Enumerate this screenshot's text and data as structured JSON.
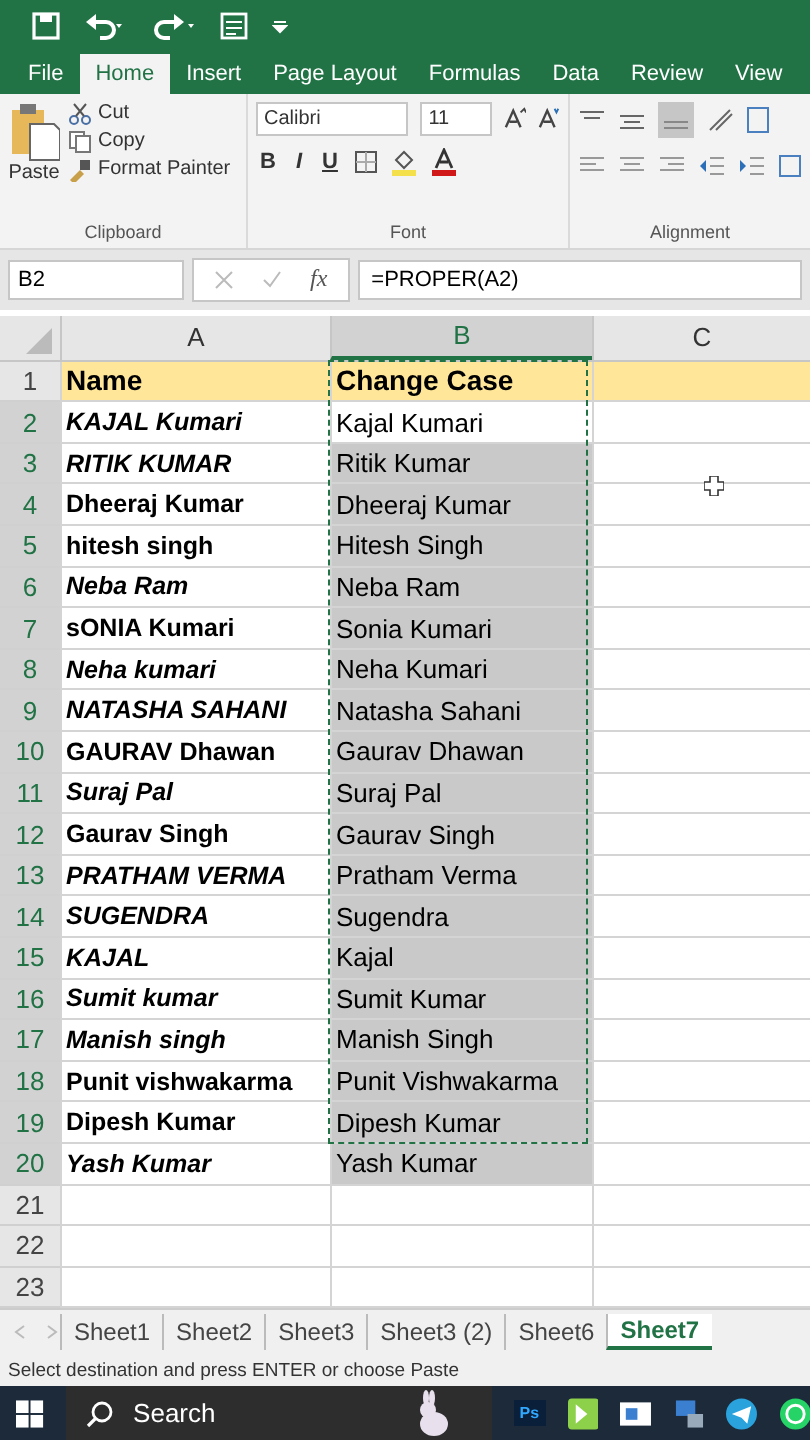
{
  "ribbon_tabs": [
    {
      "label": "File",
      "selected": false
    },
    {
      "label": "Home",
      "selected": true
    },
    {
      "label": "Insert",
      "selected": false
    },
    {
      "label": "Page Layout",
      "selected": false
    },
    {
      "label": "Formulas",
      "selected": false
    },
    {
      "label": "Data",
      "selected": false
    },
    {
      "label": "Review",
      "selected": false
    },
    {
      "label": "View",
      "selected": false
    }
  ],
  "clipboard": {
    "paste": "Paste",
    "cut": "Cut",
    "copy": "Copy",
    "format_painter": "Format Painter",
    "label": "Clipboard"
  },
  "font": {
    "name": "Calibri",
    "size": "11",
    "label": "Font",
    "bold": "B",
    "italic": "I",
    "underline": "U"
  },
  "alignment": {
    "label": "Alignment"
  },
  "formula_bar": {
    "name_box": "B2",
    "fx": "fx",
    "formula": "=PROPER(A2)"
  },
  "columns": [
    {
      "label": "A",
      "selected": false
    },
    {
      "label": "B",
      "selected": true
    },
    {
      "label": "C",
      "selected": false
    }
  ],
  "rows": [
    {
      "number": "1",
      "kind": "header",
      "a": "Name",
      "b": "Change Case",
      "selected": false
    },
    {
      "number": "2",
      "kind": "data",
      "a": "KAJAL Kumari",
      "b": "Kajal Kumari",
      "selected": true,
      "italic": true,
      "active": true
    },
    {
      "number": "3",
      "kind": "data",
      "a": "RITIK KUMAR",
      "b": "Ritik Kumar",
      "selected": true,
      "italic": true,
      "active": false
    },
    {
      "number": "4",
      "kind": "data",
      "a": "Dheeraj Kumar",
      "b": "Dheeraj Kumar",
      "selected": true,
      "italic": false,
      "active": false
    },
    {
      "number": "5",
      "kind": "data",
      "a": "hitesh singh",
      "b": "Hitesh Singh",
      "selected": true,
      "italic": false,
      "active": false
    },
    {
      "number": "6",
      "kind": "data",
      "a": "Neba Ram",
      "b": "Neba Ram",
      "selected": true,
      "italic": true,
      "active": false
    },
    {
      "number": "7",
      "kind": "data",
      "a": "sONIA Kumari",
      "b": "Sonia Kumari",
      "selected": true,
      "italic": false,
      "active": false
    },
    {
      "number": "8",
      "kind": "data",
      "a": "Neha kumari",
      "b": "Neha Kumari",
      "selected": true,
      "italic": true,
      "active": false
    },
    {
      "number": "9",
      "kind": "data",
      "a": "NATASHA SAHANI",
      "b": "Natasha Sahani",
      "selected": true,
      "italic": true,
      "active": false
    },
    {
      "number": "10",
      "kind": "data",
      "a": "GAURAV Dhawan",
      "b": "Gaurav Dhawan",
      "selected": true,
      "italic": false,
      "active": false
    },
    {
      "number": "11",
      "kind": "data",
      "a": "Suraj Pal",
      "b": "Suraj Pal",
      "selected": true,
      "italic": true,
      "active": false
    },
    {
      "number": "12",
      "kind": "data",
      "a": "Gaurav Singh",
      "b": "Gaurav Singh",
      "selected": true,
      "italic": false,
      "active": false
    },
    {
      "number": "13",
      "kind": "data",
      "a": "PRATHAM VERMA",
      "b": "Pratham Verma",
      "selected": true,
      "italic": true,
      "active": false
    },
    {
      "number": "14",
      "kind": "data",
      "a": "SUGENDRA",
      "b": "Sugendra",
      "selected": true,
      "italic": true,
      "active": false
    },
    {
      "number": "15",
      "kind": "data",
      "a": "KAJAL",
      "b": "Kajal",
      "selected": true,
      "italic": true,
      "active": false
    },
    {
      "number": "16",
      "kind": "data",
      "a": "Sumit kumar",
      "b": "Sumit Kumar",
      "selected": true,
      "italic": true,
      "active": false
    },
    {
      "number": "17",
      "kind": "data",
      "a": "Manish singh",
      "b": "Manish Singh",
      "selected": true,
      "italic": true,
      "active": false
    },
    {
      "number": "18",
      "kind": "data",
      "a": "Punit vishwakarma",
      "b": "Punit Vishwakarma",
      "selected": true,
      "italic": false,
      "active": false
    },
    {
      "number": "19",
      "kind": "data",
      "a": "Dipesh Kumar",
      "b": "Dipesh Kumar",
      "selected": true,
      "italic": false,
      "active": false
    },
    {
      "number": "20",
      "kind": "data",
      "a": "Yash Kumar",
      "b": "Yash Kumar",
      "selected": true,
      "italic": true,
      "active": false
    },
    {
      "number": "21",
      "kind": "empty",
      "selected": false
    },
    {
      "number": "22",
      "kind": "empty",
      "selected": false
    },
    {
      "number": "23",
      "kind": "empty",
      "selected": false
    }
  ],
  "sheets": [
    {
      "label": "Sheet1",
      "selected": false
    },
    {
      "label": "Sheet2",
      "selected": false
    },
    {
      "label": "Sheet3",
      "selected": false
    },
    {
      "label": "Sheet3 (2)",
      "selected": false
    },
    {
      "label": "Sheet6",
      "selected": false
    },
    {
      "label": "Sheet7",
      "selected": true
    }
  ],
  "status_bar": "Select destination and press ENTER or choose Paste",
  "taskbar": {
    "search": "Search",
    "app_label": "Ps"
  }
}
